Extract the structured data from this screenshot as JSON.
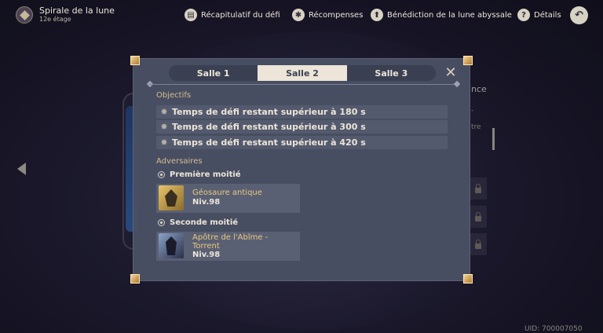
{
  "header": {
    "title": "Spirale de la lune",
    "subtitle": "12e étage",
    "actions": [
      {
        "label": "Récapitulatif du défi",
        "icon": "summary-icon"
      },
      {
        "label": "Récompenses",
        "icon": "rewards-icon"
      },
      {
        "label": "Bénédiction de la lune abyssale",
        "icon": "blessing-icon"
      },
      {
        "label": "Détails",
        "icon": "help-icon"
      }
    ],
    "back_icon": "back-icon"
  },
  "background": {
    "right_panel_fragment": "nce",
    "right_dash": "-",
    "right_text_fragment": "tre",
    "uid_fragment": "UID: 700007050"
  },
  "dialog": {
    "tabs": [
      {
        "label": "Salle 1",
        "active": false
      },
      {
        "label": "Salle 2",
        "active": true
      },
      {
        "label": "Salle 3",
        "active": false
      }
    ],
    "objectives_title": "Objectifs",
    "objectives": [
      "Temps de défi restant supérieur à 180 s",
      "Temps de défi restant supérieur à 300 s",
      "Temps de défi restant supérieur à 420 s"
    ],
    "enemies_title": "Adversaires",
    "halves": [
      {
        "label": "Première moitié",
        "enemies": [
          {
            "name": "Géosaure antique",
            "level": "Niv.98",
            "portrait": "geosaur-portrait"
          }
        ]
      },
      {
        "label": "Seconde moitié",
        "enemies": [
          {
            "name": "Apôtre de l'Abîme - Torrent",
            "level": "Niv.98",
            "portrait": "abyss-herald-portrait"
          }
        ]
      }
    ]
  },
  "colors": {
    "accent_gold": "#d3bc8e",
    "enemy_name": "#e8c77f",
    "dialog_bg": "#4a5064",
    "tab_active": "#ece5d8"
  }
}
